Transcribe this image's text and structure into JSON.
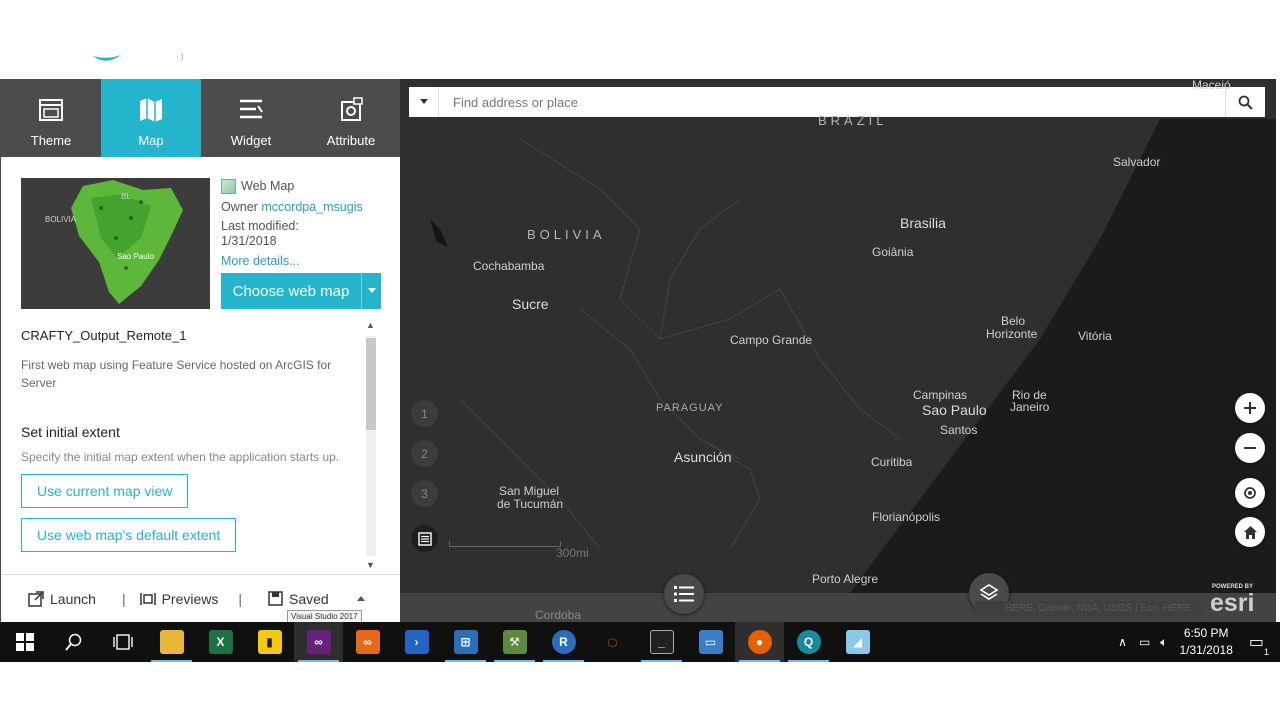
{
  "tabs": [
    {
      "label": "Theme",
      "icon": "window-icon"
    },
    {
      "label": "Map",
      "icon": "map-icon"
    },
    {
      "label": "Widget",
      "icon": "widget-list-icon"
    },
    {
      "label": "Attribute",
      "icon": "gear-icon"
    }
  ],
  "webmap": {
    "type_label": "Web Map",
    "owner_label": "Owner",
    "owner": "mccordpa_msugis",
    "modified_label": "Last modified:",
    "modified_date": "1/31/2018",
    "more_details": "More details...",
    "choose_button": "Choose web map",
    "thumb_labels": {
      "bolivia": "BOLIVIA",
      "sao_paulo": "Sao Paulo",
      "bl": "BL"
    }
  },
  "content": {
    "map_title": "CRAFTY_Output_Remote_1",
    "map_desc": "First web map using Feature Service hosted on ArcGIS for Server",
    "extent_title": "Set initial extent",
    "extent_desc": "Specify the initial map extent when the application starts up.",
    "btn_current_view": "Use current map view",
    "btn_default_extent": "Use web map's default extent"
  },
  "footer": {
    "launch": "Launch",
    "previews": "Previews",
    "saved": "Saved",
    "tooltip": "Visual Studio 2017"
  },
  "map": {
    "search_placeholder": "Find address or place",
    "places": {
      "maceio": "Maceió",
      "brazil": "BRAZIL",
      "salvador": "Salvador",
      "bolivia": "BOLIVIA",
      "brasilia": "Brasilia",
      "goiania": "Goiânia",
      "cochabamba": "Cochabamba",
      "sucre": "Sucre",
      "campo_grande": "Campo Grande",
      "belo": "Belo",
      "horizonte": "Horizonte",
      "vitoria": "Vitória",
      "paraguay": "PARAGUAY",
      "campinas": "Campinas",
      "rio": "Rio de",
      "janeiro": "Janeiro",
      "sao_paulo": "Sao Paulo",
      "santos": "Santos",
      "asuncion": "Asunción",
      "curitiba": "Curitiba",
      "san_miguel": "San Miguel",
      "tucuman": "de Tucumán",
      "florianopolis": "Florianópolis",
      "porto_alegre": "Porto Alegre",
      "cordoba": "Cordoba"
    },
    "steps": [
      "1",
      "2",
      "3"
    ],
    "scale": "300mi",
    "attribution": "HERE, Garmin, NGA, USGS | Esri, HERE",
    "powered_by": "POWERED BY",
    "esri": "esri"
  },
  "taskbar": {
    "time": "6:50 PM",
    "date": "1/31/2018",
    "notifications": "1"
  },
  "colors": {
    "accent": "#24b5cc",
    "tabbar": "#4c4c4c",
    "map_bg": "#2f2f2f",
    "taskbar": "#101010"
  }
}
